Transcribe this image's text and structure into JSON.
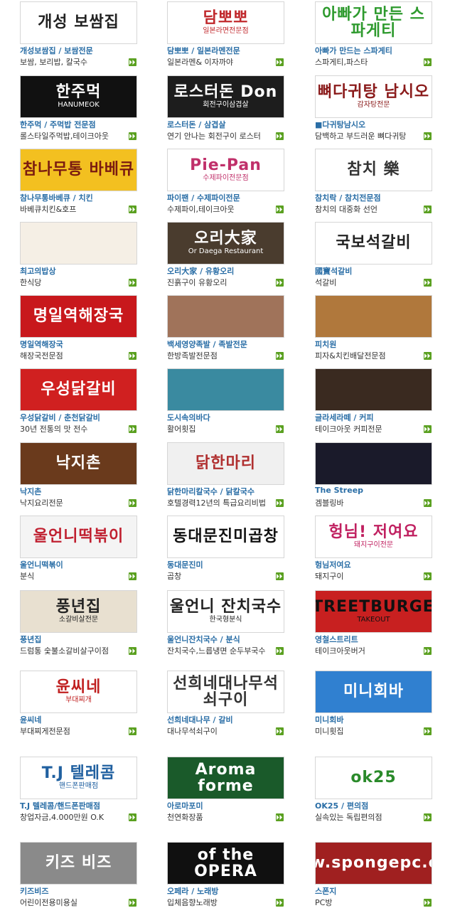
{
  "colors": {
    "name_link": "#2a6ea6",
    "desc_text": "#333333",
    "arrow_green": "#5aa020"
  },
  "arrow_icon": "double-chevron-right-icon",
  "shops": [
    {
      "name": "개성보쌈집 / 보쌈전문",
      "desc": "보쌈, 보리밥, 칼국수",
      "banner": "개성 보쌈집",
      "banner_sub": "",
      "bg": "#ffffff",
      "fg": "#222222"
    },
    {
      "name": "담뽀뽀 / 일본라멘전문",
      "desc": "일본라멘& 이자까야",
      "banner": "담뽀뽀",
      "banner_sub": "일본라면전문점",
      "bg": "#ffffff",
      "fg": "#c0282c"
    },
    {
      "name": "아빠가 만드는 스파게티",
      "desc": "스파게티,파스타",
      "banner": "아빠가 만든 스파게티",
      "banner_sub": "",
      "bg": "#ffffff",
      "fg": "#2e9a2e"
    },
    {
      "name": "한주먹 / 주먹밥 전문점",
      "desc": "롤스타일주먹밥,테이크아웃",
      "banner": "한주먹",
      "banner_sub": "HANUMEOK",
      "bg": "#111111",
      "fg": "#ffffff"
    },
    {
      "name": "로스터돈 / 삼겹살",
      "desc": "연기 안나는 회전구이 로스터",
      "banner": "로스터돈 Don",
      "banner_sub": "회전구이삼겹살",
      "bg": "#1d1d1d",
      "fg": "#ffffff"
    },
    {
      "name": "■다귀탕남시오",
      "desc": "담백하고 부드러운 뼈다귀탕",
      "banner": "뼈다귀탕 남시오",
      "banner_sub": "감자탕전문",
      "bg": "#ffffff",
      "fg": "#8a1a1a"
    },
    {
      "name": "참나무통바베큐 / 치킨",
      "desc": "바베큐치킨&호프",
      "banner": "참나무통 바베큐",
      "banner_sub": "",
      "bg": "#f3c020",
      "fg": "#7a1a10"
    },
    {
      "name": "파이팬 / 수제파이전문",
      "desc": "수제파이,테이크아웃",
      "banner": "Pie-Pan",
      "banner_sub": "수제파이전문점",
      "bg": "#ffffff",
      "fg": "#c0306a"
    },
    {
      "name": "참치락 / 참치전문점",
      "desc": "참치의 대중화 선언",
      "banner": "참치 樂",
      "banner_sub": "",
      "bg": "#ffffff",
      "fg": "#333333"
    },
    {
      "name": "최고의밥상",
      "desc": "한식당",
      "banner": "",
      "banner_sub": "",
      "bg": "#f5efe5",
      "fg": "#5a3a1a"
    },
    {
      "name": "오리大家 / 유황오리",
      "desc": "진흙구이 유황오리",
      "banner": "오리大家",
      "banner_sub": "Or Daega  Restaurant",
      "bg": "#4a3c2e",
      "fg": "#ffffff"
    },
    {
      "name": "國寶석갈비",
      "desc": "석갈비",
      "banner": "국보석갈비",
      "banner_sub": "",
      "bg": "#ffffff",
      "fg": "#222222"
    },
    {
      "name": "명일역해장국",
      "desc": "해장국전문점",
      "banner": "명일역해장국",
      "banner_sub": "",
      "bg": "#c8181c",
      "fg": "#ffffff"
    },
    {
      "name": "백세영양족발 / 족발전문",
      "desc": "한방족발전문점",
      "banner": "",
      "banner_sub": "",
      "bg": "#a0735a",
      "fg": "#ffffff"
    },
    {
      "name": "피치원",
      "desc": "피자&치킨배달전문점",
      "banner": "",
      "banner_sub": "",
      "bg": "#b0783c",
      "fg": "#ffffff"
    },
    {
      "name": "우성닭갈비 / 춘천닭갈비",
      "desc": "30년 전통의 맛 전수",
      "banner": "우성닭갈비",
      "banner_sub": "",
      "bg": "#d02020",
      "fg": "#ffffff"
    },
    {
      "name": "도시속의바다",
      "desc": "활어횟집",
      "banner": "",
      "banner_sub": "",
      "bg": "#3a8aa0",
      "fg": "#ffffff"
    },
    {
      "name": "글라세라떼 / 커피",
      "desc": "테이크아웃 커피전문",
      "banner": "",
      "banner_sub": "",
      "bg": "#3a2a20",
      "fg": "#ffffff"
    },
    {
      "name": "낙지촌",
      "desc": "낙지요리전문",
      "banner": "낙지촌",
      "banner_sub": "",
      "bg": "#6a3a1c",
      "fg": "#ffffff"
    },
    {
      "name": "닭한마리칼국수 / 닭칼국수",
      "desc": "호텔경력12년의 특급요리비법",
      "banner": "닭한마리",
      "banner_sub": "",
      "bg": "#f0f0f0",
      "fg": "#b03030"
    },
    {
      "name": "The Streep",
      "desc": "겜블링바",
      "banner": "",
      "banner_sub": "",
      "bg": "#1a1a2a",
      "fg": "#ffffff"
    },
    {
      "name": "울언니떡볶이",
      "desc": "분식",
      "banner": "울언니떡볶이",
      "banner_sub": "",
      "bg": "#f4f4f4",
      "fg": "#c02030"
    },
    {
      "name": "동대문진미",
      "desc": "곱창",
      "banner": "동대문진미곱창",
      "banner_sub": "",
      "bg": "#ffffff",
      "fg": "#111111"
    },
    {
      "name": "헝님저여요",
      "desc": "돼지구이",
      "banner": "헝님! 저여요",
      "banner_sub": "돼지구이전문",
      "bg": "#ffffff",
      "fg": "#c02060"
    },
    {
      "name": "풍년집",
      "desc": "드럼통 숯불소갈비살구이점",
      "banner": "풍년집",
      "banner_sub": "소갈비살전문",
      "bg": "#e8e0d0",
      "fg": "#222222"
    },
    {
      "name": "울언니잔치국수 / 분식",
      "desc": "잔치국수,느릅냉면 순두부국수",
      "banner": "울언니 잔치국수",
      "banner_sub": "한국형분식",
      "bg": "#ffffff",
      "fg": "#222222"
    },
    {
      "name": "영철스트리트",
      "desc": "테이크아웃버거",
      "banner": "STREETBURGER",
      "banner_sub": "TAKEOUT",
      "bg": "#c82020",
      "fg": "#111111"
    },
    {
      "name": "윤씨네",
      "desc": "부대찌게전문점",
      "banner": "윤씨네",
      "banner_sub": "부대찌개",
      "bg": "#ffffff",
      "fg": "#c02020"
    },
    {
      "name": "선희네대나무 / 갈비",
      "desc": "대나무석쇠구이",
      "banner": "선희네대나무석쇠구이",
      "banner_sub": "",
      "bg": "#ffffff",
      "fg": "#333333"
    },
    {
      "name": "미니회바",
      "desc": "미니횟집",
      "banner": "미니회바",
      "banner_sub": "",
      "bg": "#3080d0",
      "fg": "#ffffff"
    },
    {
      "name": "T.J 텔레콤/핸드폰판매점",
      "desc": "창업자금,4.000만원 O.K",
      "banner": "T.J 텔레콤",
      "banner_sub": "핸드폰판매점",
      "bg": "#ffffff",
      "fg": "#2060a0"
    },
    {
      "name": "아로마포미",
      "desc": "천연화장품",
      "banner": "Aroma forme",
      "banner_sub": "",
      "bg": "#1a5a2a",
      "fg": "#ffffff"
    },
    {
      "name": "OK25 / 편의점",
      "desc": "실속있는 독립편의점",
      "banner": "ok25",
      "banner_sub": "",
      "bg": "#ffffff",
      "fg": "#2a8a2a"
    },
    {
      "name": "키즈비즈",
      "desc": "어린이전용미용실",
      "banner": "키즈 비즈",
      "banner_sub": "",
      "bg": "#8a8a8a",
      "fg": "#ffffff"
    },
    {
      "name": "오페라 / 노래방",
      "desc": "입체음향노래방",
      "banner": "of the OPERA",
      "banner_sub": "",
      "bg": "#101010",
      "fg": "#ffffff"
    },
    {
      "name": "스폰지",
      "desc": "PC방",
      "banner": "www.spongepc.com",
      "banner_sub": "",
      "bg": "#a02020",
      "fg": "#ffffff"
    }
  ]
}
